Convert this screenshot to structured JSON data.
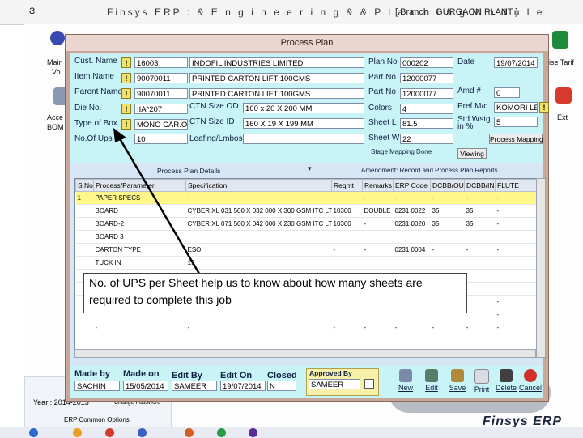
{
  "app": {
    "title": "Finsys ERP : & E n g i n e e r i n g  & &  P l a n n i n g  M o d u l e",
    "branch": "[ Branch : GURGAON PLANT ]",
    "sys_icon": "Ƨ",
    "brand": "Finsys ERP",
    "bg_labels": {
      "main_left": "Main",
      "vo_left": "Vo",
      "acce_left": "Acce",
      "bom_left": "BOM",
      "tariff_right": "ise Tarif",
      "exit_right": "Ext"
    },
    "bottom_panel": {
      "year": "Year : 2014-2015",
      "change_password": "Change Password",
      "erp_common": "ERP Common Options"
    }
  },
  "dialog": {
    "title": "Process Plan",
    "form": {
      "cust_name": {
        "label": "Cust. Name",
        "code": "16003",
        "value": "INDOFIL INDUSTRIES LIMITED"
      },
      "item_name": {
        "label": "Item Name",
        "code": "90070011",
        "value": "PRINTED CARTON LIFT 100GMS"
      },
      "parent_name": {
        "label": "Parent Name",
        "code": "90070011",
        "value": "PRINTED CARTON LIFT 100GMS"
      },
      "die_no": {
        "label": "Die No.",
        "value": "IIA*207"
      },
      "type_of_box": {
        "label": "Type of Box",
        "value": "MONO CAR.O"
      },
      "no_of_ups": {
        "label": "No.Of Ups",
        "value": "10"
      },
      "ctn_size_od": {
        "label": "CTN Size OD",
        "value": "160 x 20 X 200 MM"
      },
      "ctn_size_id": {
        "label": "CTN Size ID",
        "value": "160 X 19 X 199 MM"
      },
      "leafing": {
        "label": "Leafing/Lmbos",
        "value": ""
      },
      "plan_no": {
        "label": "Plan No",
        "value": "000202"
      },
      "part_no": {
        "label": "Part No",
        "value": "12000077"
      },
      "part_no2": {
        "label": "Part No",
        "value": "12000077"
      },
      "colors": {
        "label": "Colors",
        "value": "4"
      },
      "sheet_l": {
        "label": "Sheet L",
        "value": "81.5"
      },
      "sheet_w": {
        "label": "Sheet W",
        "value": "22"
      },
      "date": {
        "label": "Date",
        "value": "19/07/2014"
      },
      "amd": {
        "label": "Amd #",
        "value": "0"
      },
      "pref_mc": {
        "label": "Pref.M/c",
        "value": "KOMORI LE"
      },
      "std_wstg": {
        "label": "Std.Wstg in %",
        "value": "5"
      },
      "stage_mapping_done": "Stage Mapping Done",
      "viewing_btn": "Viewing",
      "process_mapping_btn": "Process Mapping"
    },
    "details": {
      "title": "Process Plan Details",
      "amendment": "Amendment: Record and Process Plan Reports",
      "columns": [
        "S.No",
        "Process/Parameter",
        "Specification",
        "Reqmt",
        "Remarks",
        "ERP Code",
        "DCBB/OUT",
        "DCBB/IN",
        "FLUTE"
      ],
      "rows": [
        [
          "1",
          "PAPER SPECS",
          "-",
          "-",
          "-",
          "-",
          "-",
          "-",
          "-"
        ],
        [
          "",
          "BOARD",
          "CYBER XL 031 500 X 032 000 X 300 GSM ITC LT",
          "10300",
          "DOUBLE",
          "0231 0022",
          "35",
          "35",
          "-"
        ],
        [
          "",
          "BOARD-2",
          "CYBER XL 071 500 X 042 000 X 230 GSM ITC LT",
          "10300",
          "-",
          "0231 0020",
          "35",
          "35",
          "-"
        ],
        [
          "",
          "BOARD 3",
          "",
          "",
          "",
          "",
          "",
          "",
          ""
        ],
        [
          "",
          "CARTON TYPE",
          "ESO",
          "-",
          "-",
          "0231 0004",
          "-",
          "-",
          "-"
        ],
        [
          "",
          "TUCK IN",
          "15",
          "",
          "",
          "",
          "",
          "",
          ""
        ],
        [
          "",
          "",
          "",
          "",
          "",
          "",
          "",
          "",
          ""
        ],
        [
          "",
          "",
          "",
          "",
          "",
          "",
          "",
          "",
          ""
        ],
        [
          "",
          "",
          "",
          "",
          "",
          "",
          "",
          "",
          "-"
        ],
        [
          "",
          "",
          "",
          "",
          "",
          "",
          "",
          "",
          "-"
        ],
        [
          "",
          "-",
          "-",
          "-",
          "-",
          "-",
          "-",
          "-",
          "-"
        ],
        [
          "",
          "",
          "",
          "",
          "",
          "",
          "",
          "",
          ""
        ]
      ]
    },
    "bottom": {
      "made_by": {
        "label": "Made by",
        "value": "SACHIN"
      },
      "made_on": {
        "label": "Made on",
        "value": "15/05/2014"
      },
      "edit_by": {
        "label": "Edit By",
        "value": "SAMEER"
      },
      "edit_on": {
        "label": "Edit On",
        "value": "19/07/2014"
      },
      "closed": {
        "label": "Closed",
        "value": "N"
      },
      "approved_by": {
        "label": "Approved By",
        "value": "SAMEER"
      }
    },
    "toolbar": {
      "new": "New",
      "edit": "Edit",
      "save": "Save",
      "print": "Print",
      "delete": "Delete",
      "cancel": "Cancel"
    }
  },
  "callout": {
    "text": "No. of UPS per Sheet help us to know about how many  sheets are required to complete this job"
  }
}
